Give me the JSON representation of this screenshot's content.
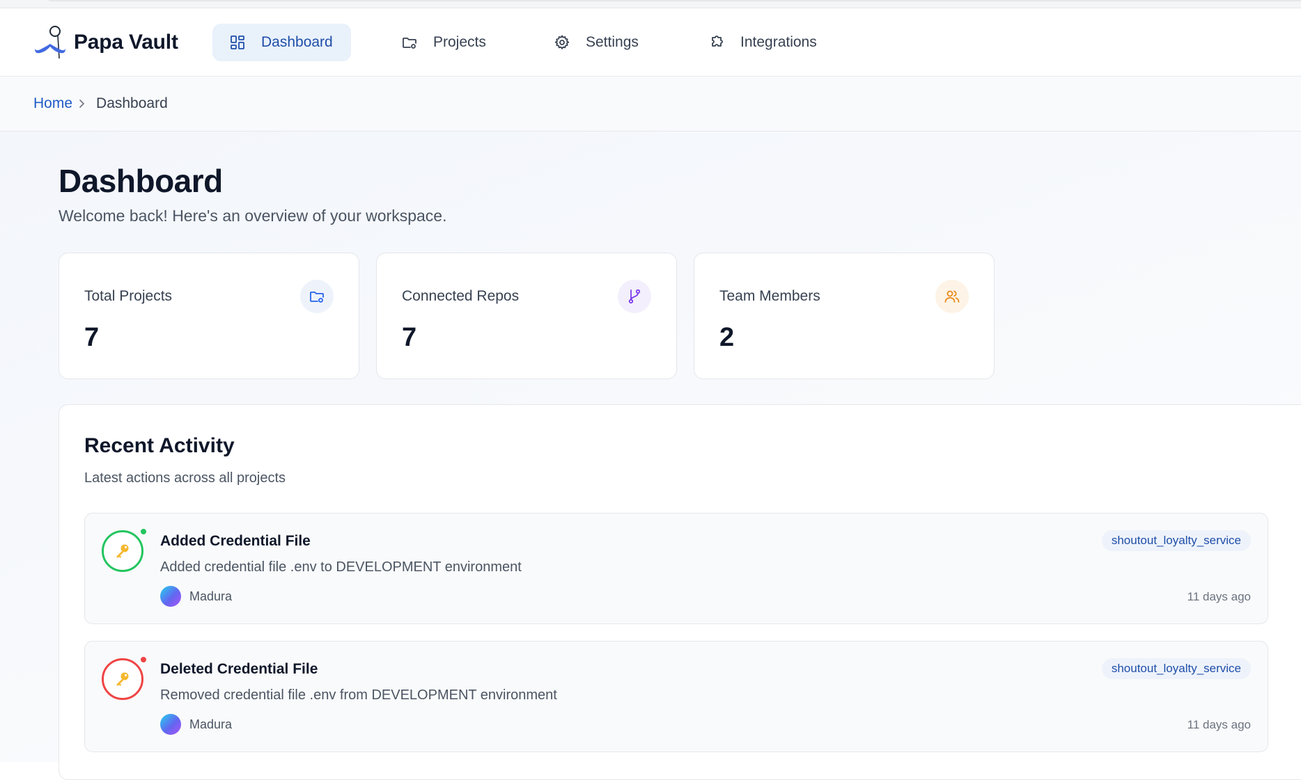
{
  "app": {
    "name": "Papa Vault",
    "logo_icon": "mustache-monocle-icon"
  },
  "nav": {
    "items": [
      {
        "label": "Dashboard",
        "icon": "grid-icon",
        "active": true
      },
      {
        "label": "Projects",
        "icon": "folder-icon",
        "active": false
      },
      {
        "label": "Settings",
        "icon": "gear-icon",
        "active": false
      },
      {
        "label": "Integrations",
        "icon": "puzzle-icon",
        "active": false
      }
    ]
  },
  "breadcrumb": {
    "home": "Home",
    "current": "Dashboard"
  },
  "page": {
    "title": "Dashboard",
    "subtitle": "Welcome back! Here's an overview of your workspace."
  },
  "stats": [
    {
      "label": "Total Projects",
      "value": "7",
      "icon": "folder-icon",
      "color": "#2563eb",
      "bg": "#eef3fb"
    },
    {
      "label": "Connected Repos",
      "value": "7",
      "icon": "git-branch-icon",
      "color": "#7c3aed",
      "bg": "#f3effc"
    },
    {
      "label": "Team Members",
      "value": "2",
      "icon": "users-icon",
      "color": "#ea8a1a",
      "bg": "#fdf4e7"
    }
  ],
  "activity": {
    "title": "Recent Activity",
    "subtitle": "Latest actions across all projects",
    "items": [
      {
        "title": "Added Credential File",
        "description": "Added credential file .env to DEVELOPMENT environment",
        "user": "Madura",
        "project": "shoutout_loyalty_service",
        "time": "11 days ago",
        "icon": "key-icon",
        "status_color": "#22c55e"
      },
      {
        "title": "Deleted Credential File",
        "description": "Removed credential file .env from DEVELOPMENT environment",
        "user": "Madura",
        "project": "shoutout_loyalty_service",
        "time": "11 days ago",
        "icon": "key-icon",
        "status_color": "#ef4444"
      }
    ]
  }
}
